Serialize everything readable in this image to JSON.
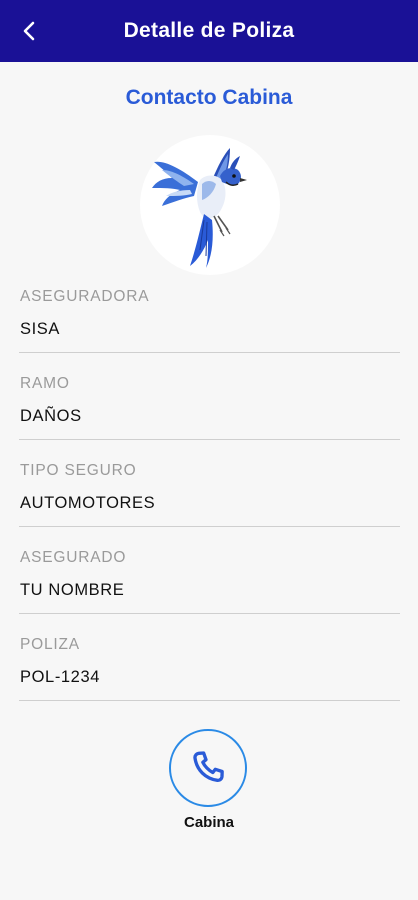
{
  "header": {
    "title": "Detalle de Poliza",
    "back_icon": "chevron-left-icon"
  },
  "section_title": "Contacto Cabina",
  "logo": {
    "icon": "blue-jay-bird-logo"
  },
  "fields": [
    {
      "label": "ASEGURADORA",
      "value": "SISA"
    },
    {
      "label": "RAMO",
      "value": "DAÑOS"
    },
    {
      "label": "TIPO SEGURO",
      "value": "AUTOMOTORES"
    },
    {
      "label": "ASEGURADO",
      "value": "TU NOMBRE"
    },
    {
      "label": "POLIZA",
      "value": "POL-1234"
    }
  ],
  "call": {
    "icon": "phone-icon",
    "label": "Cabina"
  },
  "colors": {
    "appbar": "#1a1196",
    "accent": "#2a5bd7",
    "call_ring": "#2a8ae6",
    "background": "#f7f7f7"
  }
}
